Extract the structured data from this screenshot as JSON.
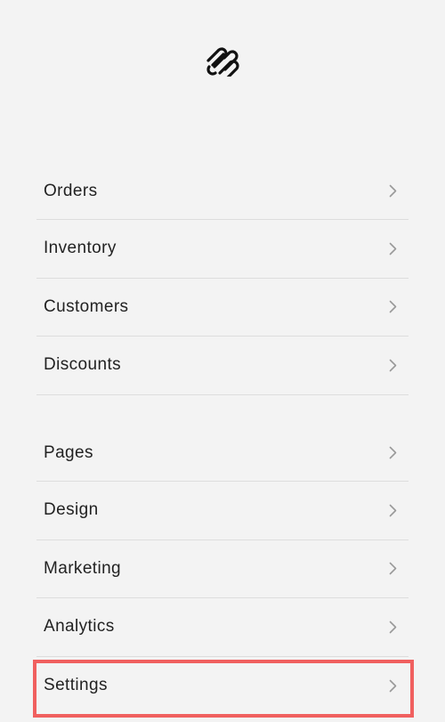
{
  "brand": {
    "logo_icon": "squarespace-logo-icon"
  },
  "menu": {
    "group1": [
      {
        "label": "Orders"
      },
      {
        "label": "Inventory"
      },
      {
        "label": "Customers"
      },
      {
        "label": "Discounts"
      }
    ],
    "group2": [
      {
        "label": "Pages"
      },
      {
        "label": "Design"
      },
      {
        "label": "Marketing"
      },
      {
        "label": "Analytics"
      },
      {
        "label": "Settings",
        "highlighted": true
      }
    ]
  },
  "icons": {
    "item_arrow": "chevron-right-icon"
  },
  "colors": {
    "background": "#f3f3f3",
    "text": "#222222",
    "divider": "#dddddd",
    "chevron": "#999999",
    "highlight": "#f0605f"
  }
}
